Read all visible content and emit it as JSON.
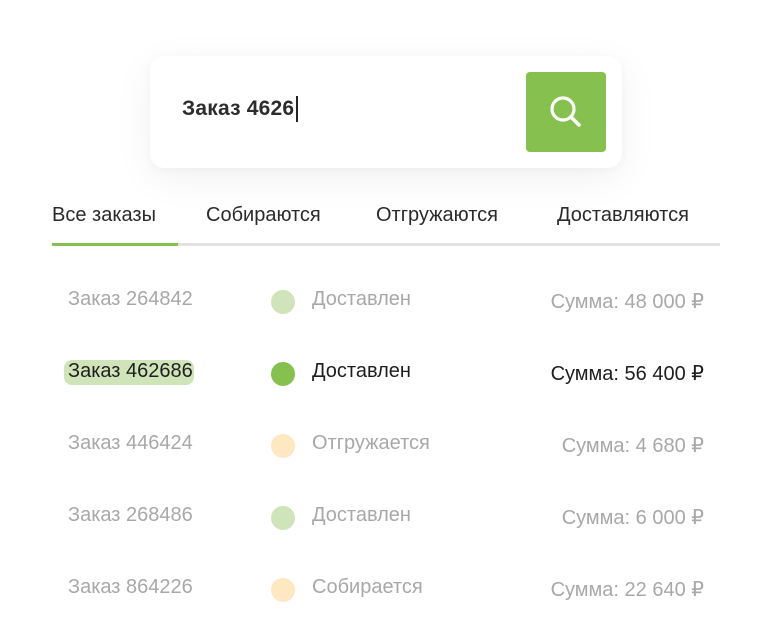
{
  "search": {
    "query": "Заказ 4626"
  },
  "tabs": [
    {
      "label": "Все заказы"
    },
    {
      "label": "Собираются"
    },
    {
      "label": "Отгружаются"
    },
    {
      "label": "Доставляются"
    }
  ],
  "orders": [
    {
      "id_label": "Заказ 264842",
      "status": "Доставлен",
      "sum": "Сумма: 48 000 ₽"
    },
    {
      "id_highlight": "Заказ 4626",
      "id_rest": "86",
      "status": "Доставлен",
      "sum": "Сумма: 56 400 ₽"
    },
    {
      "id_label": "Заказ 446424",
      "status": "Отгружается",
      "sum": "Сумма: 4 680 ₽"
    },
    {
      "id_label": "Заказ 268486",
      "status": "Доставлен",
      "sum": "Сумма: 6 000 ₽"
    },
    {
      "id_label": "Заказ 864226",
      "status": "Собирается",
      "sum": "Сумма: 22 640 ₽"
    }
  ],
  "colors": {
    "accent": "#86c04e",
    "delivered_muted": "#cfe5b9",
    "pending_muted": "#fde8c2"
  },
  "icons": {
    "search_button": "search-icon"
  }
}
